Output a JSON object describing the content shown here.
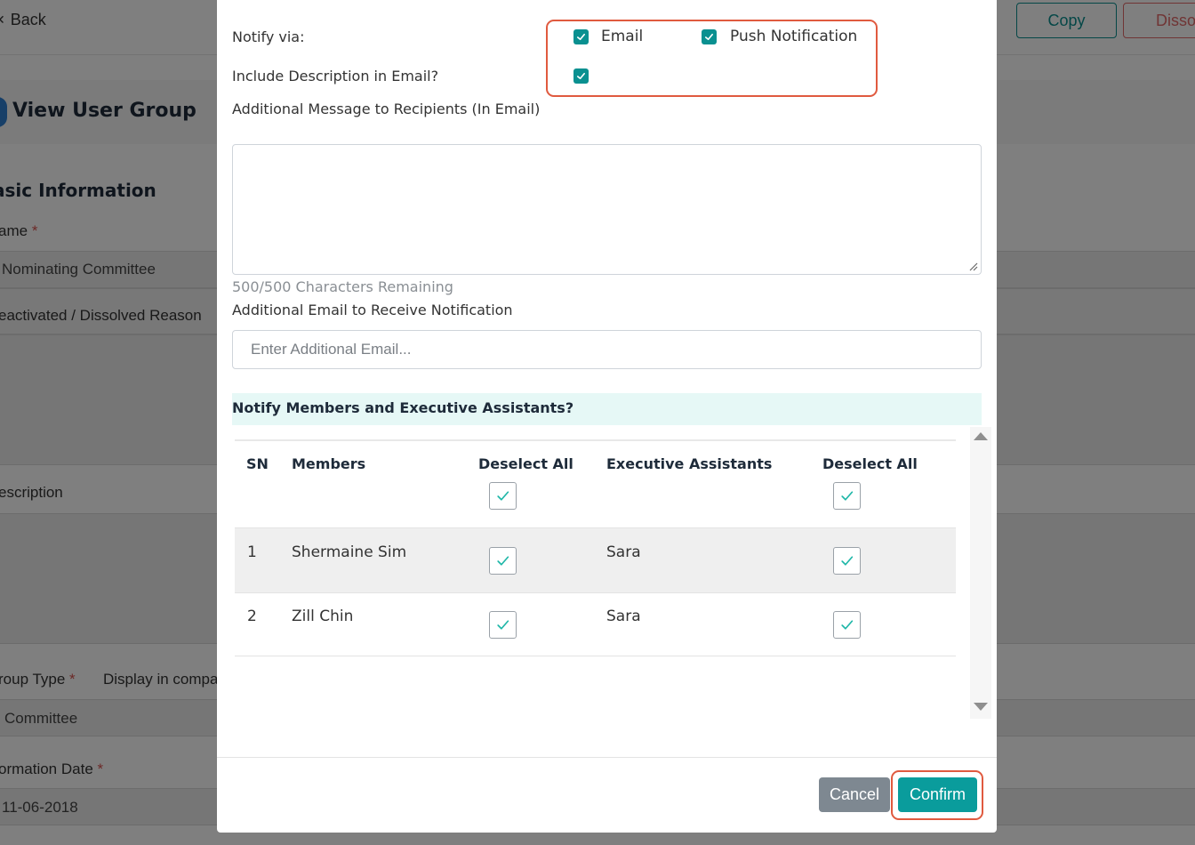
{
  "background": {
    "back_label": "Back",
    "copy_label": "Copy",
    "dissolve_label": "Disso",
    "page_title": "View User Group",
    "section_title": "asic Information",
    "name_label": "ame",
    "name_value": "Nominating Committee",
    "deactivated_label": "eactivated / Dissolved Reason",
    "description_label": "escription",
    "group_type_label": "roup Type",
    "display_label": "Display in compa",
    "group_type_value": "Committee",
    "formation_date_label": "ormation Date",
    "formation_date_value": "11-06-2018",
    "required_mark": "*"
  },
  "modal": {
    "notify_via_label": "Notify via:",
    "email_option": {
      "label": "Email",
      "checked": true
    },
    "push_option": {
      "label": "Push Notification",
      "checked": true
    },
    "include_description_label": "Include Description in Email?",
    "include_description_checked": true,
    "additional_message_label": "Additional Message to Recipients (In Email)",
    "additional_message_value": "",
    "characters_remaining": "500/500 Characters Remaining",
    "additional_email_label": "Additional Email to Receive Notification",
    "additional_email_placeholder": "Enter Additional Email...",
    "notify_members_heading": "Notify Members and Executive Assistants?",
    "table": {
      "headers": {
        "sn": "SN",
        "members": "Members",
        "members_deselect": "Deselect All",
        "assistants": "Executive Assistants",
        "assistants_deselect": "Deselect All"
      },
      "members_all_checked": true,
      "assistants_all_checked": true,
      "rows": [
        {
          "sn": "1",
          "member": "Shermaine Sim",
          "member_checked": true,
          "assistant": "Sara",
          "assistant_checked": true
        },
        {
          "sn": "2",
          "member": "Zill Chin",
          "member_checked": true,
          "assistant": "Sara",
          "assistant_checked": true
        }
      ]
    },
    "cancel_label": "Cancel",
    "confirm_label": "Confirm"
  },
  "colors": {
    "accent": "#0a9c9c",
    "highlight": "#e05a3f",
    "cancel": "#7e8891",
    "notify_bar": "#e6f8f6"
  }
}
